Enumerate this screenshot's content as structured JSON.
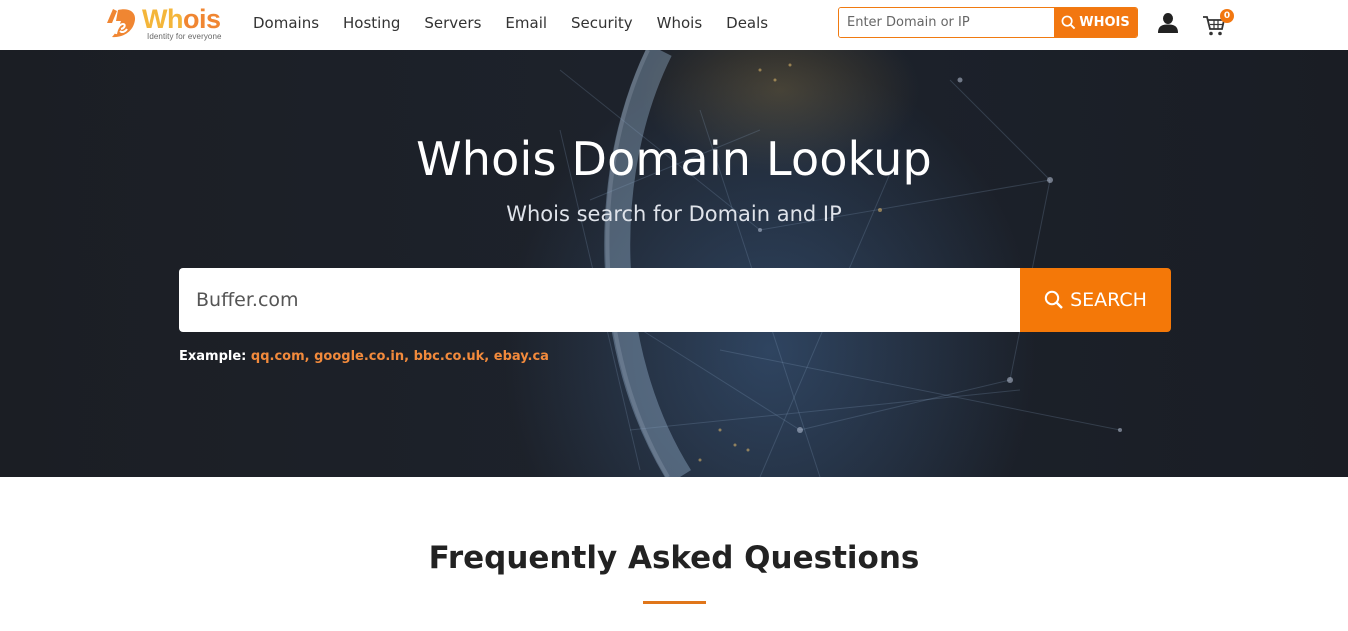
{
  "header": {
    "logo": {
      "brand": "Whois",
      "brand_part1": "Wh",
      "brand_part2": "ois",
      "tagline": "Identity for everyone"
    },
    "nav": [
      "Domains",
      "Hosting",
      "Servers",
      "Email",
      "Security",
      "Whois",
      "Deals"
    ],
    "search": {
      "placeholder": "Enter Domain or IP",
      "value": "",
      "button_label": "WHOIS",
      "button_icon": "search-icon"
    },
    "user_icon": "user-icon",
    "cart": {
      "icon": "cart-icon",
      "count": "0"
    }
  },
  "hero": {
    "title": "Whois Domain Lookup",
    "subtitle": "Whois search for Domain and IP",
    "search": {
      "value": "Buffer.com",
      "button_label": "SEARCH",
      "button_icon": "search-icon"
    },
    "examples": {
      "label": "Example:",
      "links": [
        "qq.com",
        "google.co.in",
        "bbc.co.uk",
        "ebay.ca"
      ]
    }
  },
  "faq": {
    "title": "Frequently Asked Questions"
  },
  "colors": {
    "accent": "#f47808",
    "logo_yellow": "#f4b63a",
    "logo_orange": "#f08632",
    "example_link": "#f28a3c",
    "hero_bg": "#1c212a"
  }
}
